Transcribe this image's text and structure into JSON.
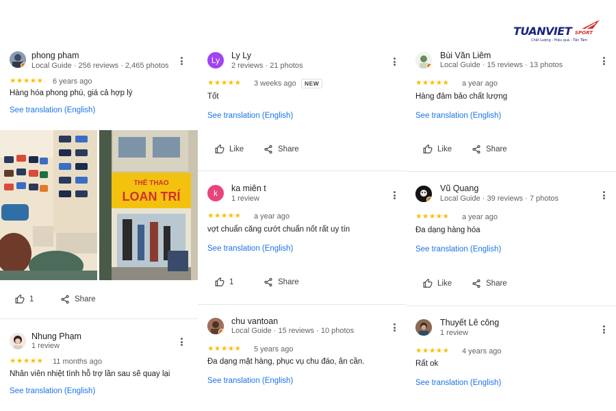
{
  "logo": {
    "brand": "TUANVIET",
    "sport": "SPORT",
    "tagline": "Chất Lượng - Hiệu quả - Tận Tâm"
  },
  "colors": {
    "star": "#fbbc04",
    "link": "#1a73e8",
    "local_guide_badge": "#e8710a"
  },
  "icons": {
    "more": "vertical-dots",
    "like": "thumbs-up",
    "share": "share-nodes",
    "star": "star"
  },
  "reviews": [
    {
      "name": "phong pham",
      "meta": "Local Guide · 256 reviews · 2,465 photos",
      "rating": 5,
      "stars": "★★★★★",
      "date": "6 years ago",
      "text": "Hàng hóa phong phú, giá cả hợp lý",
      "translate": "See translation (English)",
      "like_label": "1",
      "share_label": "Share"
    },
    {
      "name": "Nhung Phạm",
      "meta": "1 review",
      "rating": 5,
      "stars": "★★★★★",
      "date": "11 months ago",
      "text": "Nhân viên nhiệt tình hỗ trợ lần sau sẽ quay lại",
      "translate": "See translation (English)"
    },
    {
      "name": "Ly Ly",
      "avatar_letter": "Ly",
      "avatar_color": "#a142f4",
      "meta": "2 reviews · 21 photos",
      "rating": 5,
      "stars": "★★★★★",
      "date": "3 weeks ago",
      "badge": "NEW",
      "text": "Tốt",
      "translate": "See translation (English)",
      "like_label": "Like",
      "share_label": "Share"
    },
    {
      "name": "ka miên t",
      "avatar_letter": "k",
      "avatar_color": "#e8437a",
      "meta": "1 review",
      "rating": 5,
      "stars": "★★★★★",
      "date": "a year ago",
      "text": "vợt chuẩn căng cướt chuẩn nốt rất uy tín",
      "translate": "See translation (English)",
      "like_label": "1",
      "share_label": "Share"
    },
    {
      "name": "chu vantoan",
      "meta": "Local Guide · 15 reviews · 10 photos",
      "rating": 5,
      "stars": "★★★★★",
      "date": "5 years ago",
      "text": "Đa dạng mặt hàng, phục vụ chu đáo, ân cần.",
      "translate": "See translation (English)"
    },
    {
      "name": "Bùi Văn Liêm",
      "meta": "Local Guide · 15 reviews · 13 photos",
      "rating": 5,
      "stars": "★★★★★",
      "date": "a year ago",
      "text": "Hàng đảm bảo chất lượng",
      "translate": "See translation (English)",
      "like_label": "Like",
      "share_label": "Share"
    },
    {
      "name": "Vũ Quang",
      "meta": "Local Guide · 39 reviews · 7 photos",
      "rating": 5,
      "stars": "★★★★★",
      "date": "a year ago",
      "text": "Đa dạng hàng hóa",
      "translate": "See translation (English)",
      "like_label": "Like",
      "share_label": "Share"
    },
    {
      "name": "Thuyết Lê công",
      "meta": "1 review",
      "rating": 5,
      "stars": "★★★★★",
      "date": "4 years ago",
      "text": "Rất ok",
      "translate": "See translation (English)"
    }
  ],
  "photos": [
    {
      "desc": "store-interior-shoe-wall"
    },
    {
      "desc": "store-front-sign",
      "sign_line1": "THỂ THAO",
      "sign_line2": "LOAN TRÍ"
    }
  ]
}
